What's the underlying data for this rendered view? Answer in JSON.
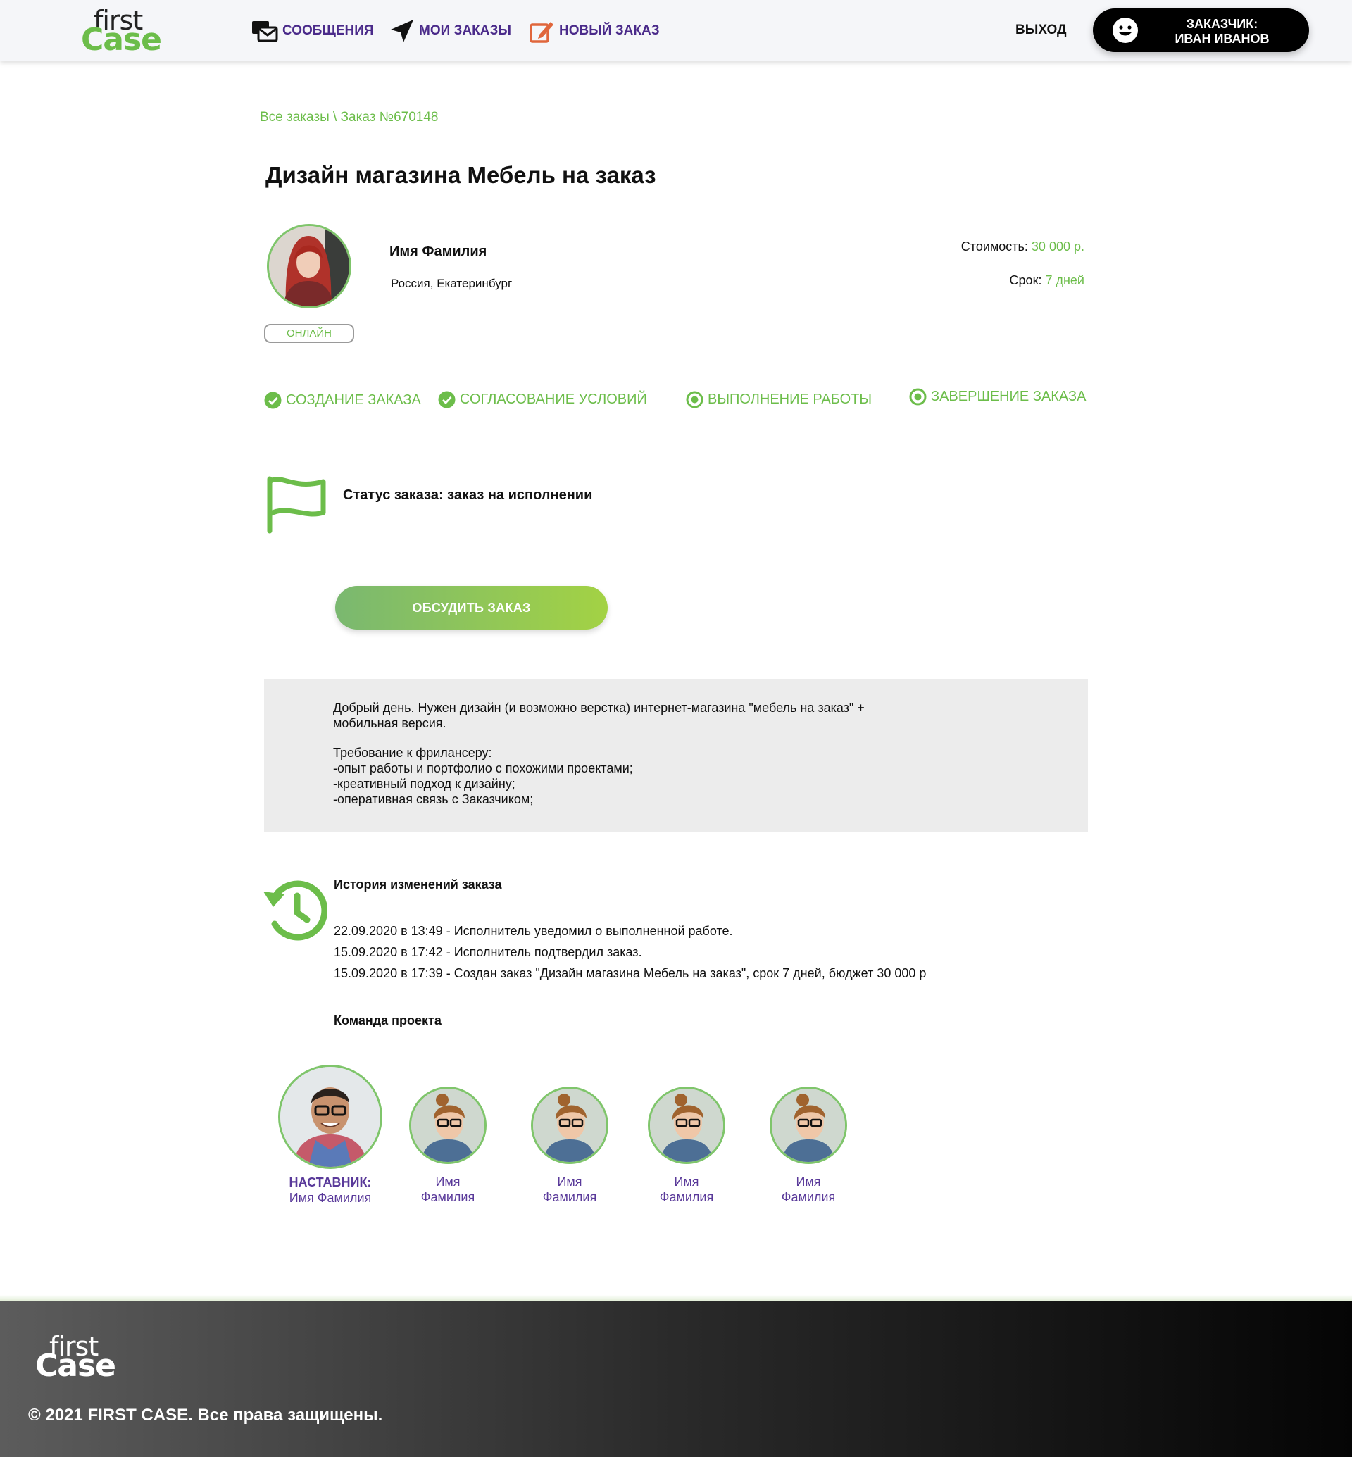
{
  "header": {
    "logo_top": "first",
    "logo_bottom": "Case",
    "nav": {
      "messages": "СООБЩЕНИЯ",
      "my_orders": "МОИ ЗАКАЗЫ",
      "new_order": "НОВЫЙ ЗАКАЗ"
    },
    "logout": "ВЫХОД",
    "user_role": "ЗАКАЗЧИК:",
    "user_name": "ИВАН ИВАНОВ"
  },
  "breadcrumb": "Все заказы \\ Заказ №670148",
  "order": {
    "title": "Дизайн магазина Мебель на заказ",
    "freelancer_name": "Имя Фамилия",
    "freelancer_location": "Россия, Екатеринбург",
    "online_status": "ОНЛАЙН",
    "cost_label": "Стоимость:",
    "cost_value": "30 000 р.",
    "deadline_label": "Срок:",
    "deadline_value": "7 дней"
  },
  "steps": [
    {
      "label": "СОЗДАНИЕ ЗАКАЗА",
      "state": "done"
    },
    {
      "label": "СОГЛАСОВАНИЕ УСЛОВИЙ",
      "state": "done"
    },
    {
      "label": "ВЫПОЛНЕНИЕ РАБОТЫ",
      "state": "pending"
    },
    {
      "label": "ЗАВЕРШЕНИЕ ЗАКАЗА",
      "state": "pending"
    }
  ],
  "status": "Статус заказа: заказ на исполнении",
  "discuss_button": "ОБСУДИТЬ ЗАКАЗ",
  "description": {
    "p1": "Добрый день. Нужен дизайн (и возможно верстка) интернет-магазина \"мебель на заказ\" + мобильная версия.",
    "p2_lines": [
      "Требование к фрилансеру:",
      "-опыт работы и портфолио с похожими проектами;",
      "-креативный подход к дизайну;",
      "-оперативная связь с Заказчиком;"
    ]
  },
  "history": {
    "title": "История изменений заказа",
    "entries": [
      "22.09.2020 в 13:49 - Исполнитель уведомил о выполненной работе.",
      "15.09.2020 в 17:42 - Исполнитель подтвердил заказ.",
      "15.09.2020 в 17:39 - Создан заказ \"Дизайн магазина Мебель на заказ\", срок 7 дней, бюджет 30 000 р"
    ]
  },
  "team": {
    "title": "Команда проекта",
    "mentor_role": "НАСТАВНИК:",
    "mentor_name": "Имя Фамилия",
    "members": [
      {
        "first": "Имя",
        "last": "Фамилия"
      },
      {
        "first": "Имя",
        "last": "Фамилия"
      },
      {
        "first": "Имя",
        "last": "Фамилия"
      },
      {
        "first": "Имя",
        "last": "Фамилия"
      }
    ]
  },
  "footer": {
    "logo_top": "first",
    "logo_bottom": "Case",
    "copyright": "© 2021 FIRST CASE. Все права защищены."
  },
  "colors": {
    "accent_green": "#6cbd4a",
    "nav_purple": "#4a2a8a",
    "member_purple": "#5a3a9a"
  },
  "icons": {
    "messages": "envelopes-icon",
    "my_orders": "paper-plane-icon",
    "new_order": "edit-icon",
    "user": "smiley-icon",
    "status": "flag-icon",
    "history": "history-icon",
    "step_done": "check-circle-icon",
    "step_pending": "target-circle-icon"
  }
}
